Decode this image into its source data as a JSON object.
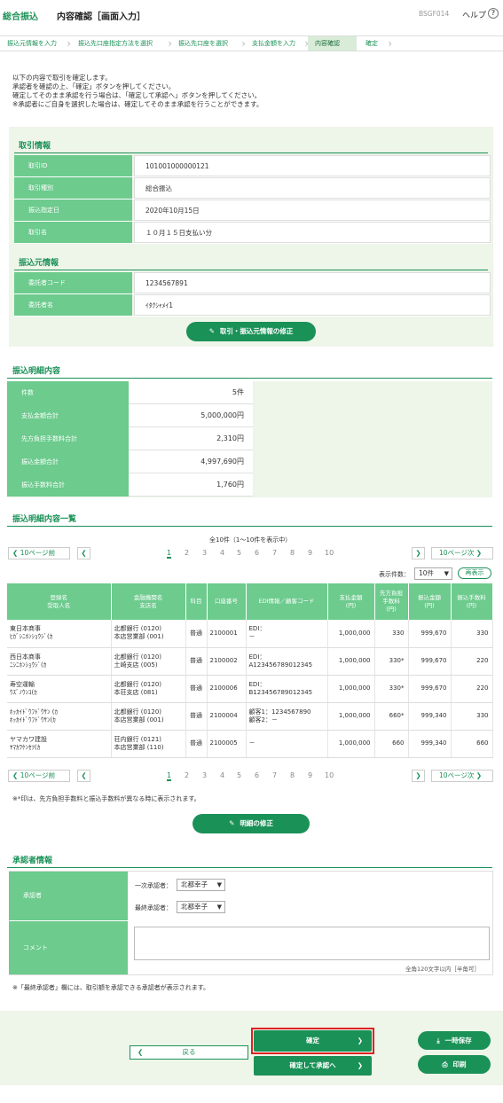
{
  "header": {
    "service": "総合振込",
    "title": "内容確認［画面入力］",
    "code": "BSGF014",
    "help": "ヘルプ",
    "help_icon": "?"
  },
  "steps": [
    "振込元情報を入力",
    "振込先口座指定方法を選択",
    "振込先口座を選択",
    "支払金額を入力",
    "内容確認",
    "確定"
  ],
  "intro": [
    "以下の内容で取引を確定します。",
    "承認者を確認の上、「確定」ボタンを押してください。",
    "確定してそのまま承認を行う場合は、「確定して承認へ」ボタンを押してください。",
    "※承認者にご自身を選択した場合は、確定してそのまま承認を行うことができます。"
  ],
  "torihiki": {
    "heading": "取引情報",
    "rows": [
      {
        "label": "取引ID",
        "value": "101001000000121"
      },
      {
        "label": "取引種別",
        "value": "総合振込"
      },
      {
        "label": "振込指定日",
        "value": "2020年10月15日"
      },
      {
        "label": "取引名",
        "value": "１０月１５日支払い分"
      }
    ]
  },
  "furikomimoto": {
    "heading": "振込元情報",
    "rows": [
      {
        "label": "委託者コード",
        "value": "1234567891"
      },
      {
        "label": "委託者名",
        "value": "ｲﾀｸｼｬﾒｲ1"
      }
    ],
    "edit_button": "取引・振込元情報の修正"
  },
  "summary": {
    "heading": "振込明細内容",
    "rows": [
      {
        "label": "件数",
        "value": "5件"
      },
      {
        "label": "支払金額合計",
        "value": "5,000,000円"
      },
      {
        "label": "先方負担手数料合計",
        "value": "2,310円"
      },
      {
        "label": "振込金額合計",
        "value": "4,997,690円"
      },
      {
        "label": "振込手数料合計",
        "value": "1,760円"
      }
    ]
  },
  "list": {
    "heading": "振込明細内容一覧",
    "count_text": "全10件（1～10件を表示中）",
    "prev10": "10ページ前",
    "next10": "10ページ次",
    "pages": [
      "1",
      "2",
      "3",
      "4",
      "5",
      "6",
      "7",
      "8",
      "9",
      "10"
    ],
    "display_label": "表示件数：",
    "display_value": "10件",
    "redisplay": "再表示",
    "columns": [
      "登録名\n受取人名",
      "金融機関名\n支店名",
      "科目",
      "口座番号",
      "EDI情報／顧客コード",
      "支払金額\n(円)",
      "先方負担\n手数料\n(円)",
      "振込金額\n(円)",
      "振込手数料\n(円)"
    ],
    "rows": [
      [
        "東日本商事\nﾋｶﾞｼﾆﾎﾝｼｮｳｼﾞ(ｶ",
        "北都銀行 (0120)\n本店営業部 (001)",
        "普通",
        "2100001",
        "EDI：\n－",
        "1,000,000",
        "330",
        "999,670",
        "330"
      ],
      [
        "西日本商事\nﾆｼﾆﾎﾝｼｮｳｼﾞ(ｶ",
        "北都銀行 (0120)\n土崎支店 (005)",
        "普通",
        "2100002",
        "EDI：\nA123456789012345",
        "1,000,000",
        "330*",
        "999,670",
        "220"
      ],
      [
        "寿空運輸\nｳｽﾞﾉｳﾝﾕ(ｶ",
        "北都銀行 (0120)\n本荘支店 (081)",
        "普通",
        "2100006",
        "EDI：\nB123456789012345",
        "1,000,000",
        "330*",
        "999,670",
        "220"
      ],
      [
        "ﾎｯｶｲﾄﾞｳﾌﾄﾞｳｻﾝ (ｶ\nﾎｯｶｲﾄﾞｳﾌﾄﾞｳｻﾝ(ｶ",
        "北都銀行 (0120)\n本店営業部 (001)",
        "普通",
        "2100004",
        "顧客1：1234567890\n顧客2：－",
        "1,000,000",
        "660*",
        "999,340",
        "330"
      ],
      [
        "ヤマカワ建設\nﾔﾏｶﾜｹﾝｾﾂ(ｶ",
        "荘内銀行 (0121)\n本店営業部 (110)",
        "普通",
        "2100005",
        "－",
        "1,000,000",
        "660",
        "999,340",
        "660"
      ]
    ],
    "note": "※*印は、先方負担手数料と振込手数料が異なる時に表示されます。",
    "edit_button": "明細の修正"
  },
  "approver": {
    "heading": "承認者情報",
    "label": "承認者",
    "first_label": "一次承認者：",
    "first_value": "北都幸子",
    "final_label": "最終承認者：",
    "final_value": "北都幸子",
    "comment_label": "コメント",
    "comment_hint": "全角120文字以内［半角可］",
    "note": "※「最終承認者」欄には、取引額を承認できる承認者が表示されます。"
  },
  "actions": {
    "confirm": "確定",
    "confirm_approve": "確定して承認へ",
    "back": "戻る",
    "save": "一時保存",
    "print": "印刷"
  }
}
